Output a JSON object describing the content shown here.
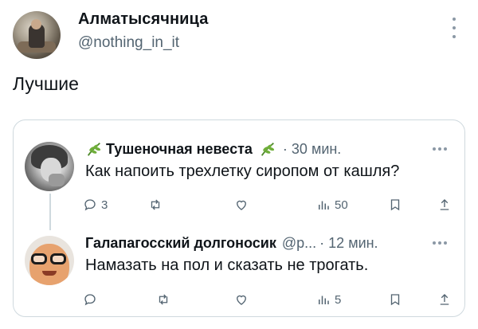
{
  "post": {
    "author_name": "Алматысячница",
    "author_handle": "@nothing_in_it",
    "text": "Лучшие"
  },
  "quoted": {
    "reply1": {
      "name": "Тушеночная невеста",
      "time": "· 30 мин.",
      "text": "Как напоить трехлетку сиропом от кашля?",
      "replies": "3",
      "views": "50"
    },
    "reply2": {
      "name": "Галапагосский долгоносик",
      "handle": "@p...",
      "time": "· 12 мин.",
      "text": "Намазать на пол и сказать не трогать.",
      "views": "5"
    }
  },
  "icons": {
    "more": "more-icon",
    "reply": "reply-icon",
    "retweet": "retweet-icon",
    "like": "heart-icon",
    "views": "views-icon",
    "bookmark": "bookmark-icon",
    "share": "share-icon",
    "name_emoji": "herb-icon"
  },
  "colors": {
    "text": "#0f1419",
    "secondary": "#536471",
    "border": "#cfd9de"
  }
}
